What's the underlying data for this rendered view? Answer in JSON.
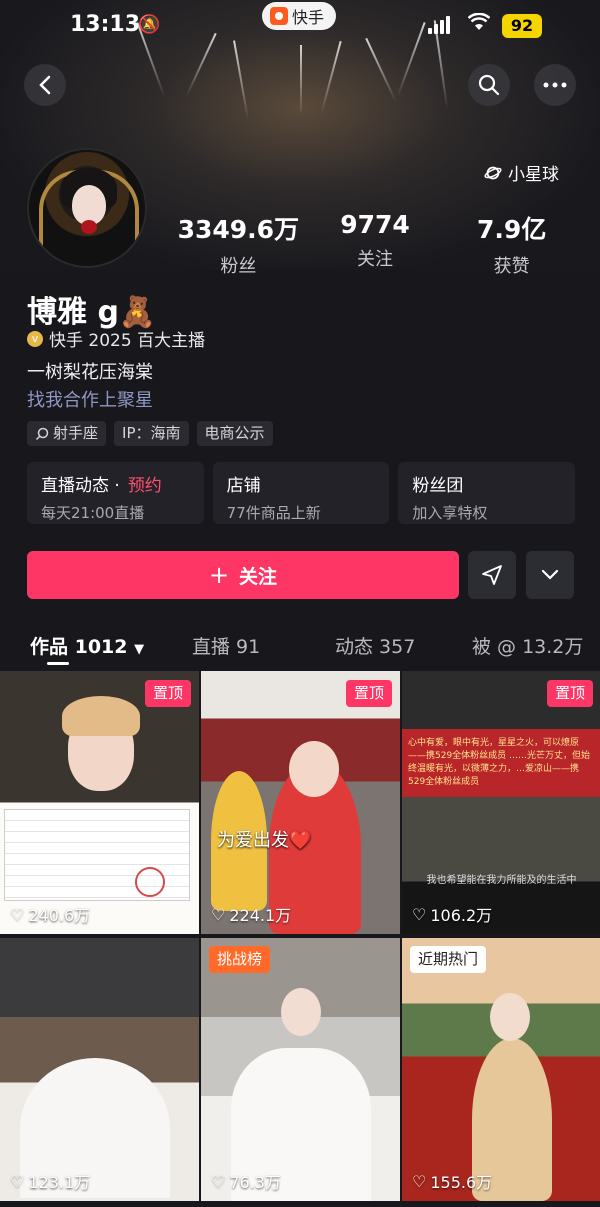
{
  "status_bar": {
    "time": "13:13",
    "app_pill": "快手",
    "battery": "92"
  },
  "header": {
    "planet_label": "小星球"
  },
  "profile": {
    "stats": [
      {
        "value": "3349.6万",
        "label": "粉丝"
      },
      {
        "value": "9774",
        "label": "关注"
      },
      {
        "value": "7.9亿",
        "label": "获赞"
      }
    ],
    "name": "博雅 g",
    "name_emoji": "🧸",
    "verified": "快手 2025 百大主播",
    "bio": "一树梨花压海棠",
    "biz_link": "找我合作上聚星",
    "tags": [
      "射手座",
      "IP：海南",
      "电商公示"
    ]
  },
  "cards": [
    {
      "title": "直播动态 ·",
      "highlight": "预约",
      "sub": "每天21:00直播"
    },
    {
      "title": "店铺",
      "highlight": "",
      "sub": "77件商品上新"
    },
    {
      "title": "粉丝团",
      "highlight": "",
      "sub": "加入享特权"
    }
  ],
  "follow_label": "关注",
  "tabs": [
    {
      "label": "作品 1012"
    },
    {
      "label": "直播 91"
    },
    {
      "label": "动态 357"
    },
    {
      "label": "被 @ 13.2万"
    }
  ],
  "grid": [
    {
      "badge": "置顶",
      "likes": "240.6万"
    },
    {
      "badge": "置顶",
      "likes": "224.1万",
      "overlay": "为爱出发❤️"
    },
    {
      "badge": "置顶",
      "likes": "106.2万",
      "caption": "我也希望能在我力所能及的生活中",
      "banner": "心中有爱，眼中有光，星星之火，可以燎原——携529全体粉丝成员 ……光芒万丈，但始终温暖有光，以微薄之力，…爱凉山——携529全体粉丝成员"
    },
    {
      "badge": "",
      "likes": "123.1万"
    },
    {
      "badge": "挑战榜",
      "likes": "76.3万"
    },
    {
      "badge": "近期热门",
      "likes": "155.6万"
    }
  ]
}
